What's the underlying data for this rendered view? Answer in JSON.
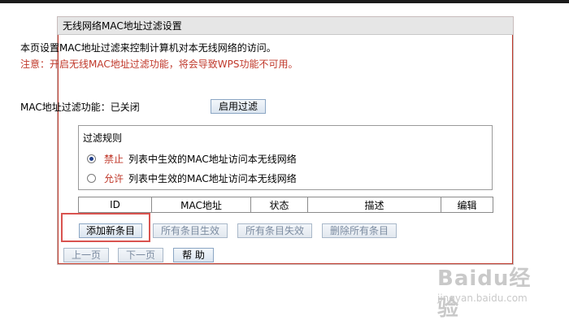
{
  "panel": {
    "title": "无线网络MAC地址过滤设置"
  },
  "description": "本页设置MAC地址过滤来控制计算机对本无线网络的访问。",
  "note": "注意：开启无线MAC地址过滤功能，将会导致WPS功能不可用。",
  "filter_status": {
    "label": "MAC地址过滤功能：已关闭",
    "enable_button": "启用过滤"
  },
  "rules": {
    "title": "过滤规则",
    "options": [
      {
        "keyword": "禁止",
        "text": "列表中生效的MAC地址访问本无线网络",
        "checked": true
      },
      {
        "keyword": "允许",
        "text": "列表中生效的MAC地址访问本无线网络",
        "checked": false
      }
    ]
  },
  "table": {
    "columns": [
      "ID",
      "MAC地址",
      "状态",
      "描述",
      "编辑"
    ]
  },
  "actions": {
    "add": "添加新条目",
    "enable_all": "所有条目生效",
    "disable_all": "所有条目失效",
    "delete_all": "删除所有条目"
  },
  "nav": {
    "prev": "上一页",
    "next": "下一页",
    "help": "帮 助"
  },
  "watermark": {
    "main": "Baidu经验",
    "sub": "jingyan.baidu.com"
  },
  "colors": {
    "accent_red": "#c0392b",
    "button_border": "#8ba6c4"
  }
}
